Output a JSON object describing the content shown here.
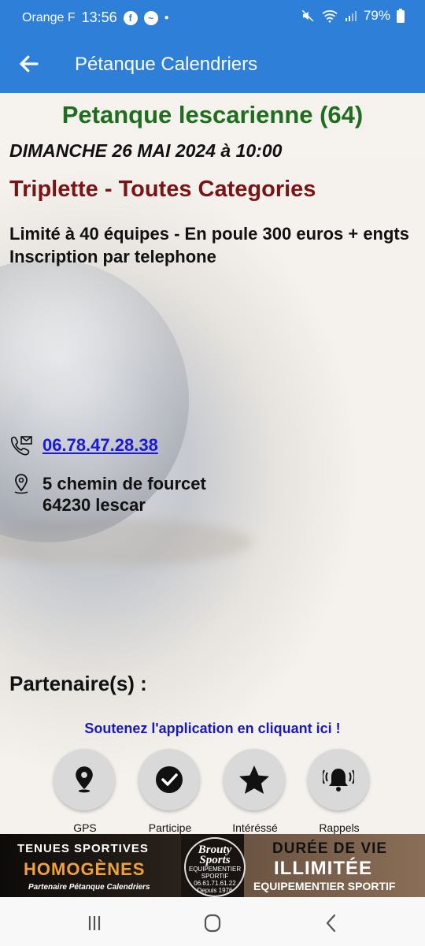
{
  "status": {
    "carrier": "Orange F",
    "time": "13:56",
    "battery": "79%"
  },
  "app": {
    "title": "Pétanque Calendriers"
  },
  "event": {
    "club": "Petanque lescarienne (64)",
    "date": "DIMANCHE 26 MAI 2024 à 10:00",
    "type": "Triplette - Toutes Categories",
    "description_line1": "Limité à 40 équipes - En poule 300 euros + engts",
    "description_line2": "Inscription par telephone",
    "phone": "06.78.47.28.38",
    "address_line1": "5 chemin de fourcet",
    "address_line2": "64230 lescar"
  },
  "partners": {
    "title": "Partenaire(s) :",
    "support_text": "Soutenez l'application en cliquant ici !"
  },
  "actions": [
    {
      "label": "GPS",
      "icon": "location-pin-icon"
    },
    {
      "label": "Participe",
      "icon": "check-circle-icon"
    },
    {
      "label": "Intéréssé",
      "icon": "star-icon"
    },
    {
      "label": "Rappels",
      "icon": "bell-ringing-icon"
    }
  ],
  "banner": {
    "left_line1": "TENUES SPORTIVES",
    "left_line2": "HOMOGÈNES",
    "left_line3": "Partenaire Pétanque Calendriers",
    "logo_line1": "Brouty",
    "logo_line2": "Sports",
    "logo_line3": "EQUIPEMENTIER SPORTIF",
    "logo_line4": "06.61.71.61.22",
    "logo_line5": "Depuis 1976",
    "right_line1": "DURÉE DE VIE",
    "right_line2": "ILLIMITÉE",
    "right_line3": "EQUIPEMENTIER SPORTIF"
  }
}
